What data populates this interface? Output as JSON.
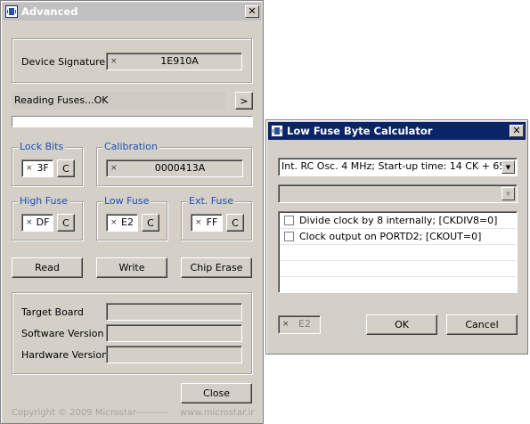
{
  "advanced": {
    "title": "Advanced",
    "close_glyph": "✕",
    "device_signature_label": "Device Signature",
    "device_signature_value": "1E910A",
    "status_text": "Reading Fuses...OK",
    "go_button": ">",
    "progress": 0,
    "lock_bits": {
      "label": "Lock Bits",
      "value": "3F",
      "clear": "C"
    },
    "calibration": {
      "label": "Calibration",
      "value": "0000413A"
    },
    "high_fuse": {
      "label": "High Fuse",
      "value": "DF",
      "clear": "C"
    },
    "low_fuse": {
      "label": "Low Fuse",
      "value": "E2",
      "clear": "C"
    },
    "ext_fuse": {
      "label": "Ext. Fuse",
      "value": "FF",
      "clear": "C"
    },
    "read_button": "Read",
    "write_button": "Write",
    "chip_erase_button": "Chip Erase",
    "target_board_label": "Target Board",
    "software_version_label": "Software Version",
    "hardware_version_label": "Hardware Version",
    "close_button": "Close",
    "footer_copyright": "Copyright © 2009 Microstar",
    "footer_sep": "----------",
    "footer_url": "www.microstar.ir",
    "x_glyph": "×"
  },
  "calculator": {
    "title": "Low Fuse Byte Calculator",
    "close_glyph": "✕",
    "clock_select": "Int. RC Osc. 4 MHz; Start-up time: 14 CK + 65",
    "second_select": "",
    "options": [
      {
        "label": "Divide clock by 8 internally; [CKDIV8=0]",
        "checked": false
      },
      {
        "label": "Clock output on PORTD2; [CKOUT=0]",
        "checked": false
      }
    ],
    "result_value": "E2",
    "ok_button": "OK",
    "cancel_button": "Cancel",
    "arrow_glyph": "▼"
  }
}
